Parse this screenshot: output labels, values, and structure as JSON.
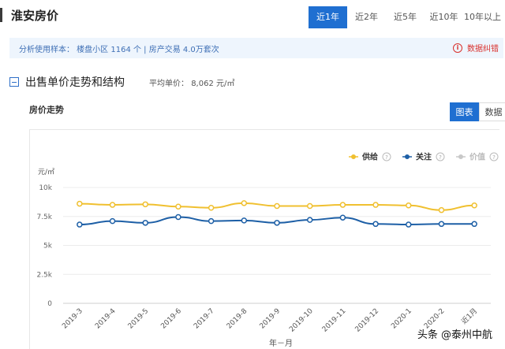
{
  "page": {
    "title": "淮安房价"
  },
  "range_tabs": [
    {
      "label": "近1年",
      "active": true
    },
    {
      "label": "近2年",
      "active": false
    },
    {
      "label": "近5年",
      "active": false
    },
    {
      "label": "近10年",
      "active": false
    },
    {
      "label": "10年以上",
      "active": false
    }
  ],
  "info": {
    "text": "分析使用样本：  楼盘小区 1164 个   |   房产交易 4.0万套次",
    "report_label": "数据纠错",
    "report_icon": "info-circle-icon",
    "colors": {
      "report": "#d9302c",
      "info_bg": "#eef5fd"
    }
  },
  "section": {
    "title": "出售单价走势和结构",
    "avg_price_label": "平均单价：",
    "avg_price_value": "8,062 元/㎡"
  },
  "trend": {
    "label": "房价走势",
    "view_buttons": [
      {
        "label": "图表",
        "active": true
      },
      {
        "label": "数据",
        "active": false
      }
    ]
  },
  "chart_data": {
    "type": "line",
    "ylabel": "元/㎡",
    "xlabel": "年－月",
    "ylim": [
      0,
      10000
    ],
    "y_ticks": [
      {
        "value": 0,
        "label": "0"
      },
      {
        "value": 2500,
        "label": "2.5k"
      },
      {
        "value": 5000,
        "label": "5k"
      },
      {
        "value": 7500,
        "label": "7.5k"
      },
      {
        "value": 10000,
        "label": "10k"
      }
    ],
    "categories": [
      "2019-3",
      "2019-4",
      "2019-5",
      "2019-6",
      "2019-7",
      "2019-8",
      "2019-9",
      "2019-10",
      "2019-11",
      "2019-12",
      "2020-1",
      "2020-2",
      "近1月"
    ],
    "series": [
      {
        "name": "供给",
        "color": "#f0c030",
        "values": [
          8600,
          8500,
          8550,
          8350,
          8250,
          8650,
          8400,
          8400,
          8500,
          8500,
          8450,
          8050,
          8450
        ]
      },
      {
        "name": "关注",
        "color": "#1d5fa6",
        "values": [
          6800,
          7100,
          6950,
          7450,
          7100,
          7150,
          6950,
          7200,
          7400,
          6850,
          6800,
          6850,
          6850
        ]
      }
    ],
    "legend": [
      {
        "name": "供给",
        "color": "#f0c030",
        "enabled": true
      },
      {
        "name": "关注",
        "color": "#1d5fa6",
        "enabled": true
      },
      {
        "name": "价值",
        "color": "#c8c8c8",
        "enabled": false
      }
    ],
    "legend_position": "top-right",
    "grid": true
  },
  "watermark": "头条 @泰州中航"
}
